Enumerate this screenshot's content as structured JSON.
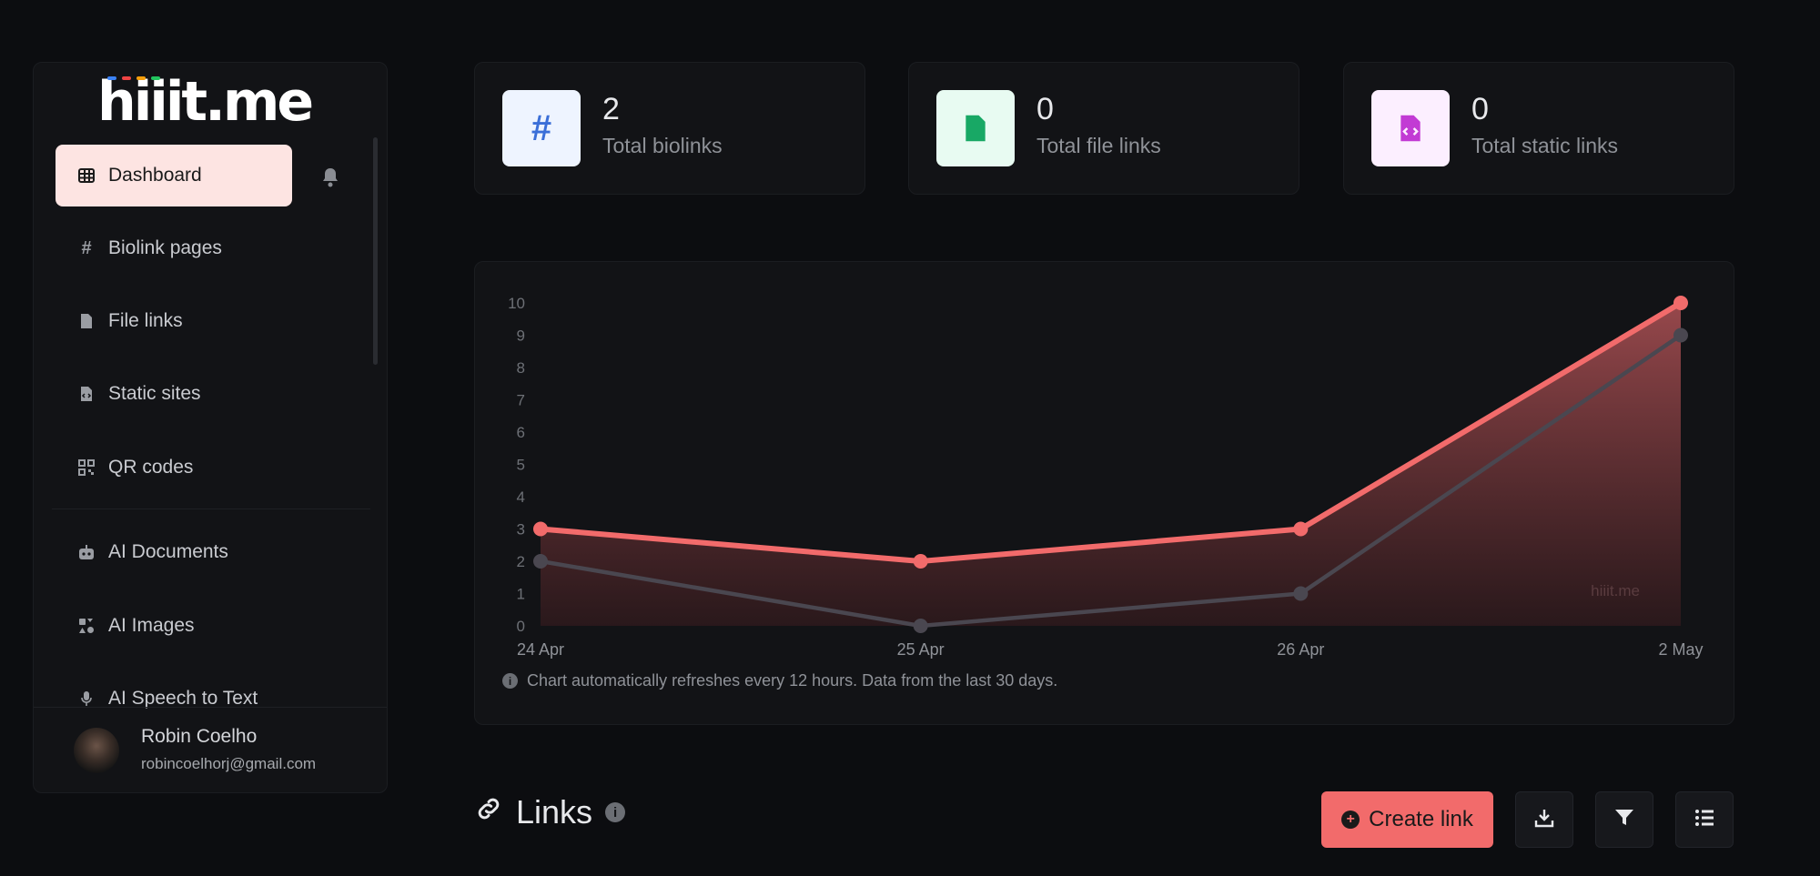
{
  "sidebar": {
    "logo": "hiiit.me",
    "logo_dot_colors": [
      "#3b82f6",
      "#ef4444",
      "#f59e0b",
      "#22c55e"
    ],
    "items": [
      {
        "label": "Dashboard",
        "icon": "grid-icon",
        "active": true
      },
      {
        "label": "Biolink pages",
        "icon": "hash-icon"
      },
      {
        "label": "File links",
        "icon": "file-icon"
      },
      {
        "label": "Static sites",
        "icon": "file-code-icon"
      },
      {
        "label": "QR codes",
        "icon": "qrcode-icon"
      },
      {
        "label": "AI Documents",
        "icon": "robot-icon"
      },
      {
        "label": "AI Images",
        "icon": "icons-icon"
      },
      {
        "label": "AI Speech to Text",
        "icon": "microphone-icon"
      }
    ],
    "user": {
      "name": "Robin Coelho",
      "email": "robincoelhorj@gmail.com"
    }
  },
  "stats": [
    {
      "value": "2",
      "label": "Total biolinks",
      "icon": "hash-icon",
      "bg": "#eef4ff",
      "fg": "#3b6fd8"
    },
    {
      "value": "0",
      "label": "Total file links",
      "icon": "file-icon",
      "bg": "#e8fbf2",
      "fg": "#18a865"
    },
    {
      "value": "0",
      "label": "Total static links",
      "icon": "file-code-icon",
      "bg": "#fcefff",
      "fg": "#c23bd4"
    }
  ],
  "chart_data": {
    "type": "area",
    "categories": [
      "24 Apr",
      "25 Apr",
      "26 Apr",
      "2 May"
    ],
    "series": [
      {
        "values": [
          3,
          2,
          3,
          10
        ],
        "color": "#f26b6b"
      },
      {
        "values": [
          2,
          0,
          1,
          9
        ],
        "color": "#4a4750"
      }
    ],
    "ylim": [
      0,
      10
    ],
    "yticks": [
      "0",
      "1",
      "2",
      "3",
      "4",
      "5",
      "6",
      "7",
      "8",
      "9",
      "10"
    ],
    "watermark": "hiiit.me",
    "grid": false
  },
  "chart_note": "Chart automatically refreshes every 12 hours. Data from the last 30 days.",
  "links": {
    "title": "Links",
    "create_label": "Create link"
  },
  "colors": {
    "accent": "#f26b6b",
    "background": "#0c0d10",
    "card": "#121316"
  }
}
